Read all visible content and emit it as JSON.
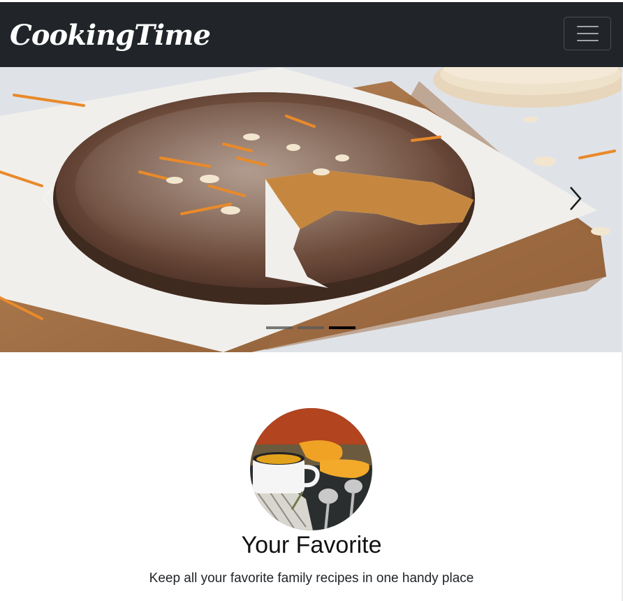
{
  "navbar": {
    "brand": "CookingTime",
    "toggler_icon": "hamburger-menu-icon",
    "background": "#212529"
  },
  "carousel": {
    "slide_image": "carrot-cake-on-parchment-photo",
    "prev_icon": "chevron-left-icon",
    "next_icon": "chevron-right-icon",
    "slide_count": 3,
    "active_index": 3
  },
  "feature": {
    "image": "pumpkin-soup-mug-photo",
    "title": "Your Favorite",
    "text": "Keep all your favorite family recipes in one handy place"
  }
}
